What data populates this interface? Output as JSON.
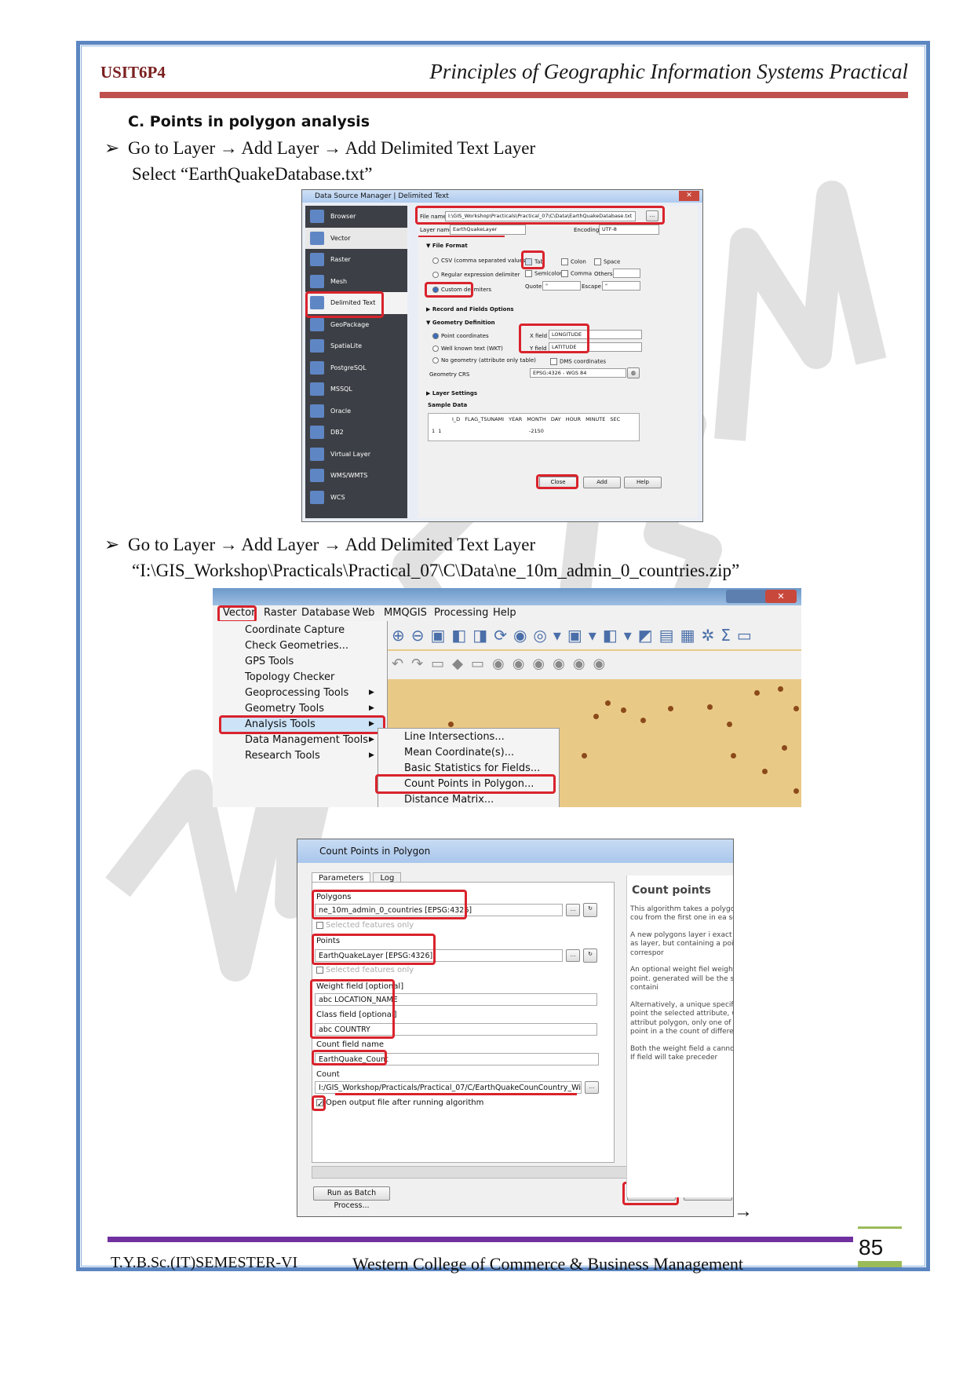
{
  "header": {
    "code": "USIT6P4",
    "title": "Principles of Geographic Information Systems Practical"
  },
  "section": {
    "heading": "C.  Points in polygon analysis"
  },
  "steps": [
    {
      "bullet": "➢",
      "line1": "Go to Layer → Add Layer → Add Delimited Text Layer",
      "line2": "Select “EarthQuakeDatabase.txt”"
    },
    {
      "bullet": "➢",
      "line1": "Go to Layer → Add Layer → Add Delimited Text Layer",
      "line2": "“I:\\GIS_Workshop\\Practicals\\Practical_07\\C\\Data\\ne_10m_admin_0_countries.zip”"
    }
  ],
  "dsm": {
    "title": "Data Source Manager | Delimited Text",
    "sidebar": [
      "Browser",
      "Vector",
      "Raster",
      "Mesh",
      "Delimited Text",
      "GeoPackage",
      "SpatiaLite",
      "PostgreSQL",
      "MSSQL",
      "Oracle",
      "DB2",
      "Virtual Layer",
      "WMS/WMTS",
      "WCS"
    ],
    "file_name_label": "File name",
    "file_name_value": "I:\\GIS_Workshop\\Practicals\\Practical_07\\C\\Data\\EarthQuakeDatabase.txt",
    "layer_name_label": "Layer name",
    "layer_name_value": "EarthQuakeLayer",
    "encoding_label": "Encoding",
    "encoding_value": "UTF-8",
    "file_format": "File Format",
    "csv": "CSV (comma separated values)",
    "regex": "Regular expression delimiter",
    "custom": "Custom delimiters",
    "tab": "Tab",
    "colon": "Colon",
    "space": "Space",
    "semicolon": "Semicolon",
    "comma": "Comma",
    "others": "Others",
    "quote": "Quote",
    "quote_val": "\"",
    "escape": "Escape",
    "escape_val": "\"",
    "record_fields": "Record and Fields Options",
    "geom_def": "Geometry Definition",
    "point_coords": "Point coordinates",
    "wkt": "Well known text (WKT)",
    "no_geom": "No geometry (attribute only table)",
    "x_field": "X field",
    "x_value": "LONGITUDE",
    "y_field": "Y field",
    "y_value": "LATITUDE",
    "dms": "DMS coordinates",
    "geom_crs": "Geometry CRS",
    "crs_value": "EPSG:4326 - WGS 84",
    "layer_settings": "Layer Settings",
    "sample_data": "Sample Data",
    "table_headers": [
      "I_D",
      "FLAG_TSUNAMI",
      "YEAR",
      "MONTH",
      "DAY",
      "HOUR",
      "MINUTE",
      "SEC"
    ],
    "table_row": [
      "1",
      "1",
      "",
      "-2150",
      "",
      "",
      "",
      ""
    ],
    "close": "Close",
    "add": "Add",
    "help": "Help"
  },
  "qgis_menu": {
    "menubar": [
      "Vector",
      "Raster",
      "Database",
      "Web",
      "MMQGIS",
      "Processing",
      "Help"
    ],
    "items": [
      "Coordinate Capture",
      "Check Geometries...",
      "GPS Tools",
      "Topology Checker",
      "Geoprocessing Tools",
      "Geometry Tools",
      "Analysis Tools",
      "Data Management Tools",
      "Research Tools"
    ],
    "submenu": [
      "Line Intersections...",
      "Mean Coordinate(s)...",
      "Basic Statistics for Fields...",
      "Count Points in Polygon...",
      "Distance Matrix..."
    ]
  },
  "cpp": {
    "title": "Count Points in Polygon",
    "tabs": [
      "Parameters",
      "Log"
    ],
    "polygons_label": "Polygons",
    "polygons_value": "ne_10m_admin_0_countries [EPSG:4326]",
    "selected_only": "Selected features only",
    "points_label": "Points",
    "points_value": "EarthQuakeLayer [EPSG:4326]",
    "weight_label": "Weight field [optional]",
    "weight_value": "abc LOCATION_NAME",
    "class_label": "Class field [optional]",
    "class_value": "abc COUNTRY",
    "count_name_label": "Count field name",
    "count_name_value": "EarthQuake_Count",
    "count_label": "Count",
    "count_value": "I:/GIS_Workshop/Practicals/Practical_07/C/EarthQuakeCounCountry_Wise.shp",
    "open_output": "Open output file after running algorithm",
    "batch": "Run as Batch Process...",
    "run": "Run",
    "help_title": "Count points",
    "help_paras": [
      "This algorithm takes a polygon layer and cou from the first one in ea second one.",
      "A new polygons layer i exact same content as layer, but containing a points count correspor",
      "An optional weight fiel weights to each point. generated will be the s for each point containi",
      "Alternatively, a unique specified. If set, point the selected attribute, with the same attribut polygon, only one of t count of the point in a the count of different it.",
      "Both the weight field a cannot be specified. If field will take preceder"
    ]
  },
  "footer": {
    "left": "T.Y.B.Sc.(IT)SEMESTER-VI",
    "center": "Western College of Commerce & Business Management",
    "page": "85"
  },
  "trailing_arrow": "→",
  "colors": {
    "frame": "#5b86c1",
    "header_rule": "#c0504d",
    "footer_bar": "#7030a0",
    "page_accent": "#9bbb59",
    "highlight": "#d9232c"
  }
}
